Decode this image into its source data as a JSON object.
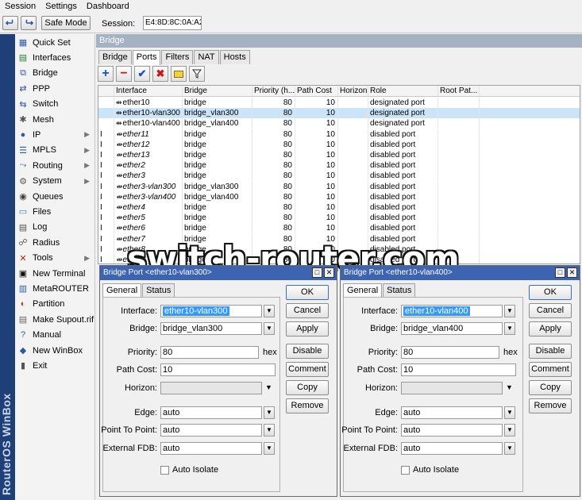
{
  "menu": [
    "Session",
    "Settings",
    "Dashboard"
  ],
  "toolbar": {
    "undo_icon": "undo-icon",
    "redo_icon": "redo-icon",
    "safe_mode_label": "Safe Mode",
    "session_label": "Session:",
    "session_value": "E4:8D:8C:0A:A2:D5"
  },
  "sidebar": {
    "brand_text": "RouterOS WinBox",
    "items": [
      {
        "label": "Quick Set",
        "icon": "quickset-icon",
        "arrow": false
      },
      {
        "label": "Interfaces",
        "icon": "interfaces-icon",
        "arrow": false
      },
      {
        "label": "Bridge",
        "icon": "bridge-icon",
        "arrow": false
      },
      {
        "label": "PPP",
        "icon": "ppp-icon",
        "arrow": false
      },
      {
        "label": "Switch",
        "icon": "switch-icon",
        "arrow": false
      },
      {
        "label": "Mesh",
        "icon": "mesh-icon",
        "arrow": false
      },
      {
        "label": "IP",
        "icon": "ip-icon",
        "arrow": true
      },
      {
        "label": "MPLS",
        "icon": "mpls-icon",
        "arrow": true
      },
      {
        "label": "Routing",
        "icon": "routing-icon",
        "arrow": true
      },
      {
        "label": "System",
        "icon": "system-icon",
        "arrow": true
      },
      {
        "label": "Queues",
        "icon": "queues-icon",
        "arrow": false
      },
      {
        "label": "Files",
        "icon": "files-icon",
        "arrow": false
      },
      {
        "label": "Log",
        "icon": "log-icon",
        "arrow": false
      },
      {
        "label": "Radius",
        "icon": "radius-icon",
        "arrow": false
      },
      {
        "label": "Tools",
        "icon": "tools-icon",
        "arrow": true
      },
      {
        "label": "New Terminal",
        "icon": "terminal-icon",
        "arrow": false
      },
      {
        "label": "MetaROUTER",
        "icon": "metarouter-icon",
        "arrow": false
      },
      {
        "label": "Partition",
        "icon": "partition-icon",
        "arrow": false
      },
      {
        "label": "Make Supout.rif",
        "icon": "supout-icon",
        "arrow": false
      },
      {
        "label": "Manual",
        "icon": "manual-icon",
        "arrow": false
      },
      {
        "label": "New WinBox",
        "icon": "winbox-icon",
        "arrow": false
      },
      {
        "label": "Exit",
        "icon": "exit-icon",
        "arrow": false
      }
    ]
  },
  "bridge_window": {
    "title": "Bridge",
    "tabs": [
      "Bridge",
      "Ports",
      "Filters",
      "NAT",
      "Hosts"
    ],
    "active_tab": "Ports",
    "tools": [
      "add-icon",
      "remove-icon",
      "enable-icon",
      "disable-icon",
      "comment-icon",
      "filter-icon"
    ],
    "columns": [
      "Interface",
      "Bridge",
      "Priority (h...",
      "Path Cost",
      "Horizon",
      "Role",
      "Root Pat..."
    ],
    "rows": [
      {
        "flag": "",
        "interface": "ether10",
        "bridge": "bridge",
        "priority": "80",
        "path_cost": "10",
        "horizon": "",
        "role": "designated port",
        "italic": false,
        "selected": false
      },
      {
        "flag": "",
        "interface": "ether10-vlan300",
        "bridge": "bridge_vlan300",
        "priority": "80",
        "path_cost": "10",
        "horizon": "",
        "role": "designated port",
        "italic": false,
        "selected": true
      },
      {
        "flag": "",
        "interface": "ether10-vlan400",
        "bridge": "bridge_vlan400",
        "priority": "80",
        "path_cost": "10",
        "horizon": "",
        "role": "designated port",
        "italic": false,
        "selected": false
      },
      {
        "flag": "I",
        "interface": "ether11",
        "bridge": "bridge",
        "priority": "80",
        "path_cost": "10",
        "horizon": "",
        "role": "disabled port",
        "italic": true,
        "selected": false
      },
      {
        "flag": "I",
        "interface": "ether12",
        "bridge": "bridge",
        "priority": "80",
        "path_cost": "10",
        "horizon": "",
        "role": "disabled port",
        "italic": true,
        "selected": false
      },
      {
        "flag": "I",
        "interface": "ether13",
        "bridge": "bridge",
        "priority": "80",
        "path_cost": "10",
        "horizon": "",
        "role": "disabled port",
        "italic": true,
        "selected": false
      },
      {
        "flag": "I",
        "interface": "ether2",
        "bridge": "bridge",
        "priority": "80",
        "path_cost": "10",
        "horizon": "",
        "role": "disabled port",
        "italic": true,
        "selected": false
      },
      {
        "flag": "I",
        "interface": "ether3",
        "bridge": "bridge",
        "priority": "80",
        "path_cost": "10",
        "horizon": "",
        "role": "disabled port",
        "italic": true,
        "selected": false
      },
      {
        "flag": "I",
        "interface": "ether3-vlan300",
        "bridge": "bridge_vlan300",
        "priority": "80",
        "path_cost": "10",
        "horizon": "",
        "role": "disabled port",
        "italic": true,
        "selected": false
      },
      {
        "flag": "I",
        "interface": "ether3-vlan400",
        "bridge": "bridge_vlan400",
        "priority": "80",
        "path_cost": "10",
        "horizon": "",
        "role": "disabled port",
        "italic": true,
        "selected": false
      },
      {
        "flag": "I",
        "interface": "ether4",
        "bridge": "bridge",
        "priority": "80",
        "path_cost": "10",
        "horizon": "",
        "role": "disabled port",
        "italic": true,
        "selected": false
      },
      {
        "flag": "I",
        "interface": "ether5",
        "bridge": "bridge",
        "priority": "80",
        "path_cost": "10",
        "horizon": "",
        "role": "disabled port",
        "italic": true,
        "selected": false
      },
      {
        "flag": "I",
        "interface": "ether6",
        "bridge": "bridge",
        "priority": "80",
        "path_cost": "10",
        "horizon": "",
        "role": "disabled port",
        "italic": true,
        "selected": false
      },
      {
        "flag": "I",
        "interface": "ether7",
        "bridge": "bridge",
        "priority": "80",
        "path_cost": "10",
        "horizon": "",
        "role": "disabled port",
        "italic": true,
        "selected": false
      },
      {
        "flag": "I",
        "interface": "ether8",
        "bridge": "bridge",
        "priority": "80",
        "path_cost": "10",
        "horizon": "",
        "role": "disabled port",
        "italic": true,
        "selected": false
      },
      {
        "flag": "I",
        "interface": "ether9",
        "bridge": "bridge",
        "priority": "80",
        "path_cost": "10",
        "horizon": "",
        "role": "disabled port",
        "italic": true,
        "selected": false
      }
    ]
  },
  "watermark": "switch-router.com",
  "dialogs": [
    {
      "title": "Bridge Port <ether10-vlan300>",
      "tabs": [
        "General",
        "Status"
      ],
      "fields": {
        "interface_label": "Interface:",
        "interface_value": "ether10-vlan300",
        "bridge_label": "Bridge:",
        "bridge_value": "bridge_vlan300",
        "priority_label": "Priority:",
        "priority_value": "80",
        "priority_suffix": "hex",
        "path_cost_label": "Path Cost:",
        "path_cost_value": "10",
        "horizon_label": "Horizon:",
        "horizon_value": "",
        "edge_label": "Edge:",
        "edge_value": "auto",
        "p2p_label": "Point To Point:",
        "p2p_value": "auto",
        "fdb_label": "External FDB:",
        "fdb_value": "auto",
        "auto_isolate_label": "Auto Isolate"
      },
      "buttons": [
        "OK",
        "Cancel",
        "Apply",
        "Disable",
        "Comment",
        "Copy",
        "Remove"
      ]
    },
    {
      "title": "Bridge Port <ether10-vlan400>",
      "tabs": [
        "General",
        "Status"
      ],
      "fields": {
        "interface_label": "Interface:",
        "interface_value": "ether10-vlan400",
        "bridge_label": "Bridge:",
        "bridge_value": "bridge_vlan400",
        "priority_label": "Priority:",
        "priority_value": "80",
        "priority_suffix": "hex",
        "path_cost_label": "Path Cost:",
        "path_cost_value": "10",
        "horizon_label": "Horizon:",
        "horizon_value": "",
        "edge_label": "Edge:",
        "edge_value": "auto",
        "p2p_label": "Point To Point:",
        "p2p_value": "auto",
        "fdb_label": "External FDB:",
        "fdb_value": "auto",
        "auto_isolate_label": "Auto Isolate"
      },
      "buttons": [
        "OK",
        "Cancel",
        "Apply",
        "Disable",
        "Comment",
        "Copy",
        "Remove"
      ]
    }
  ],
  "colors": {
    "sidebar_strip": "#1e3f78",
    "dialog_title": "#3d64b0",
    "selection": "#cce4f7",
    "field_highlight": "#3399ff"
  }
}
